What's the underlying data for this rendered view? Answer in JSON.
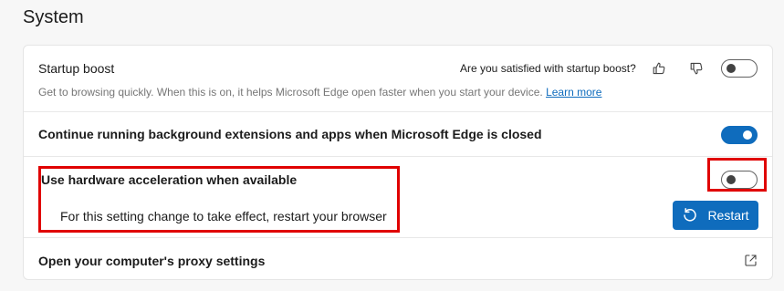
{
  "page": {
    "title": "System"
  },
  "settings": {
    "startup_boost": {
      "title": "Startup boost",
      "description": "Get to browsing quickly. When this is on, it helps Microsoft Edge open faster when you start your device.",
      "learn_more": "Learn more",
      "feedback_question": "Are you satisfied with startup boost?",
      "like_icon": "thumbs-up-icon",
      "dislike_icon": "thumbs-down-icon",
      "enabled": false
    },
    "background_extensions": {
      "title": "Continue running background extensions and apps when Microsoft Edge is closed",
      "enabled": true
    },
    "hardware_acceleration": {
      "title": "Use hardware acceleration when available",
      "restart_notice": "For this setting change to take effect, restart your browser",
      "restart_label": "Restart",
      "restart_icon": "restart-icon",
      "enabled": false
    },
    "proxy": {
      "title": "Open your computer's proxy settings",
      "icon": "open-external-icon"
    }
  },
  "colors": {
    "accent": "#0f6cbd",
    "highlight": "#e00000",
    "toggle_off_border": "#616161",
    "description_text": "#767676"
  }
}
